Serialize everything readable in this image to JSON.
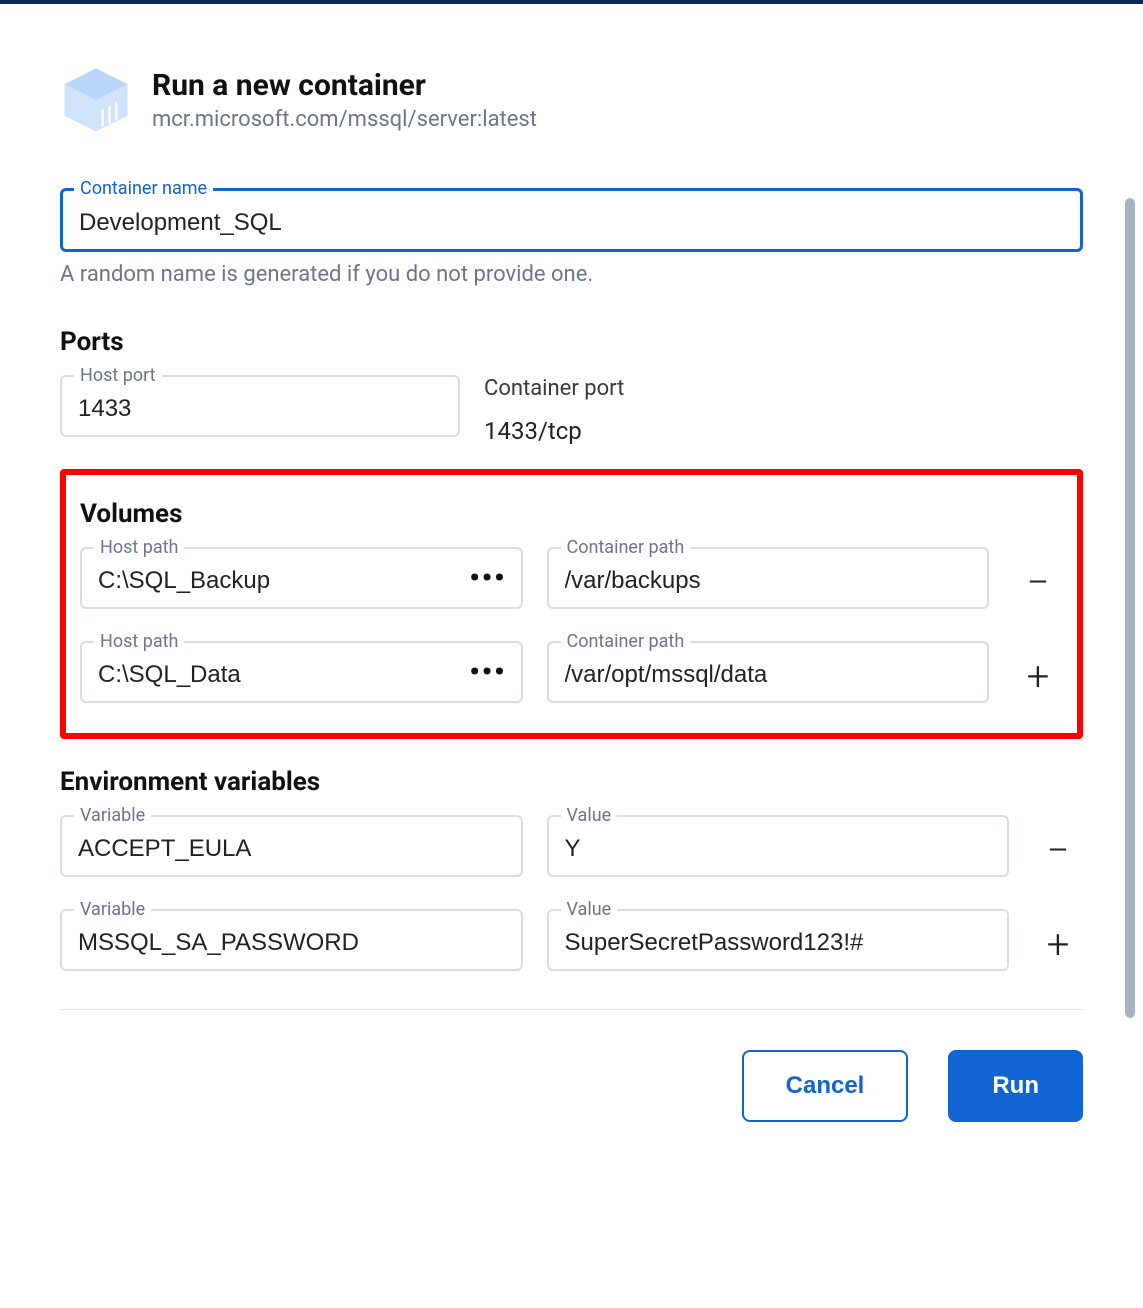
{
  "header": {
    "title": "Run a new container",
    "image_ref": "mcr.microsoft.com/mssql/server:latest"
  },
  "container_name": {
    "label": "Container name",
    "value": "Development_SQL",
    "hint": "A random name is generated if you do not provide one."
  },
  "ports": {
    "title": "Ports",
    "host_label": "Host port",
    "host_value": "1433",
    "container_label": "Container port",
    "container_value": "1433/tcp"
  },
  "volumes": {
    "title": "Volumes",
    "host_label": "Host path",
    "container_label": "Container path",
    "rows": [
      {
        "host": "C:\\SQL_Backup",
        "container": "/var/backups"
      },
      {
        "host": "C:\\SQL_Data",
        "container": "/var/opt/mssql/data"
      }
    ]
  },
  "env": {
    "title": "Environment variables",
    "var_label": "Variable",
    "val_label": "Value",
    "rows": [
      {
        "variable": "ACCEPT_EULA",
        "value": "Y"
      },
      {
        "variable": "MSSQL_SA_PASSWORD",
        "value": "SuperSecretPassword123!#"
      }
    ]
  },
  "footer": {
    "cancel": "Cancel",
    "run": "Run"
  },
  "glyphs": {
    "ellipsis": "•••",
    "minus": "−",
    "plus": "+"
  }
}
